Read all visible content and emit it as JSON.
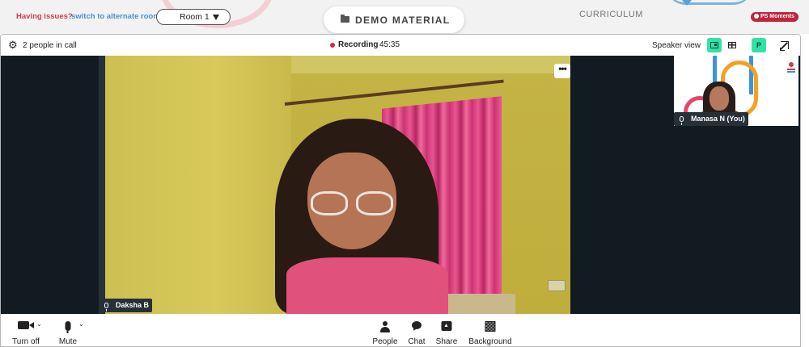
{
  "topbar": {
    "issue_text": "Having issues?",
    "issue_link": "switch to alternate room",
    "room_label": "Room 1",
    "demo_tab": "DEMO MATERIAL",
    "curriculum_tab": "CURRICULUM",
    "ps_moments": "PS Moments",
    "icons": {
      "room_caret": "caret-down-icon",
      "demo_folder": "folder-icon"
    }
  },
  "call_header": {
    "people_count": "2 people in call",
    "recording_label": "Recording",
    "recording_time": "45:35",
    "speaker_view_label": "Speaker view",
    "p_button": "P",
    "colors": {
      "recording": "#d4284a",
      "active_toggle": "#2fe3a6"
    }
  },
  "participants": {
    "main": {
      "name": "Daksha B"
    },
    "self": {
      "name": "Manasa N (You)"
    }
  },
  "more_menu": "•••",
  "controls": {
    "camera": "Turn off",
    "mute": "Mute",
    "people": "People",
    "chat": "Chat",
    "share": "Share",
    "background": "Background"
  }
}
